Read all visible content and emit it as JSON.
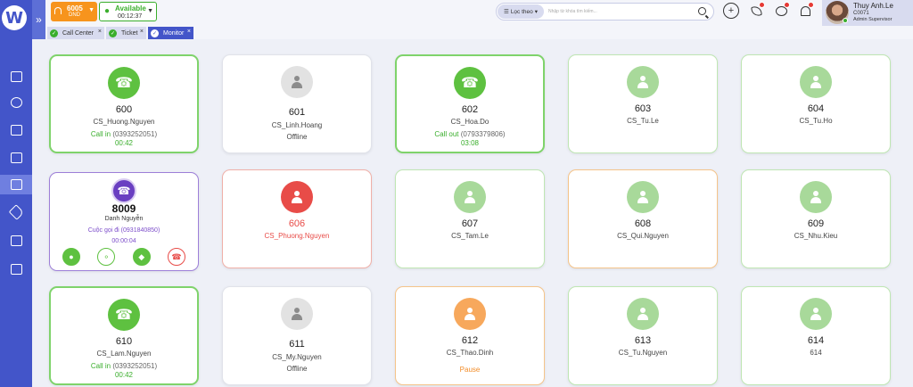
{
  "sidebar": {
    "logo": "W",
    "items": [
      {
        "name": "dashboard-icon"
      },
      {
        "name": "headset-icon"
      },
      {
        "name": "ticket-icon"
      },
      {
        "name": "camera-icon"
      },
      {
        "name": "contact-card-icon",
        "active": true
      },
      {
        "name": "tag-icon"
      },
      {
        "name": "folders-icon"
      },
      {
        "name": "report-icon"
      }
    ]
  },
  "topbar": {
    "expand_glyph": "»",
    "extension": {
      "number": "6005",
      "sub": "DND"
    },
    "status": {
      "label": "Available",
      "timer": "00:12:37"
    },
    "search": {
      "filter_label": "Lọc theo",
      "placeholder": "Nhập từ khóa tìm kiếm..."
    },
    "add_glyph": "+",
    "user": {
      "name": "Thuy Anh.Le",
      "code": "C0071",
      "role": "Admin Supervisor"
    }
  },
  "tabs": [
    {
      "label": "Call Center",
      "close": "×"
    },
    {
      "label": "Ticket",
      "close": "×"
    },
    {
      "label": "Monitor",
      "close": "×"
    }
  ],
  "agents": [
    {
      "ext": "600",
      "name": "CS_Huong.Nguyen",
      "line1_label": "Call in",
      "line1_number": "(0393252051)",
      "line2": "00:42"
    },
    {
      "ext": "601",
      "name": "CS_Linh.Hoang",
      "line1_label": "Offline"
    },
    {
      "ext": "602",
      "name": "CS_Hoa.Do",
      "line1_label": "Call out",
      "line1_number": "(0793379806)",
      "line2": "03:08"
    },
    {
      "ext": "603",
      "name": "CS_Tu.Le"
    },
    {
      "ext": "604",
      "name": "CS_Tu.Ho"
    },
    {
      "ext": "8009",
      "name": "Danh Nguyễn",
      "line1": "Cuộc gọi đi (0931840850)",
      "line2": "00:00:04"
    },
    {
      "ext": "606",
      "name": "CS_Phuong.Nguyen"
    },
    {
      "ext": "607",
      "name": "CS_Tam.Le"
    },
    {
      "ext": "608",
      "name": "CS_Qui.Nguyen"
    },
    {
      "ext": "609",
      "name": "CS_Nhu.Kieu"
    },
    {
      "ext": "610",
      "name": "CS_Lam.Nguyen",
      "line1_label": "Call in",
      "line1_number": "(0393252051)",
      "line2": "00:42"
    },
    {
      "ext": "611",
      "name": "CS_My.Nguyen",
      "line1_label": "Offline"
    },
    {
      "ext": "612",
      "name": "CS_Thao.Dinh",
      "line1_label": "Pause"
    },
    {
      "ext": "613",
      "name": "CS_Tu.Nguyen"
    },
    {
      "ext": "614",
      "name": "614"
    }
  ],
  "colors": {
    "accent": "#4355c9",
    "green": "#5ec140",
    "red": "#e84c48",
    "orange": "#f7a85c",
    "purple": "#6a3fc1"
  }
}
